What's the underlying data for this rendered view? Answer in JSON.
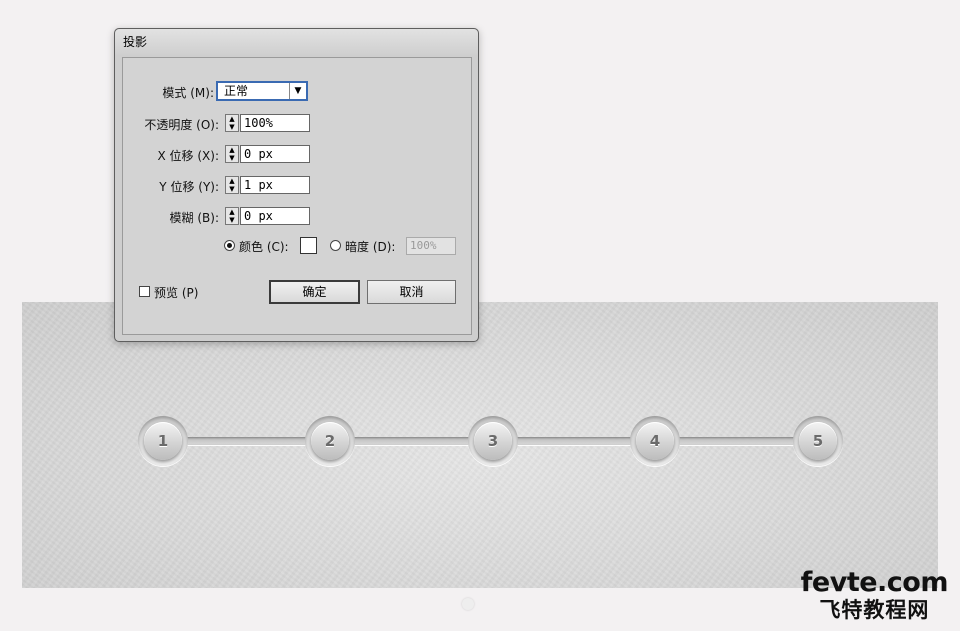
{
  "dialog": {
    "title": "投影",
    "mode_label": "模式 (M):",
    "mode_value": "正常",
    "opacity_label": "不透明度 (O):",
    "opacity_value": "100%",
    "x_offset_label": "X 位移 (X):",
    "x_offset_value": "0 px",
    "y_offset_label": "Y 位移 (Y):",
    "y_offset_value": "1 px",
    "blur_label": "模糊 (B):",
    "blur_value": "0 px",
    "color_label": "颜色 (C):",
    "color_swatch": "#ffffff",
    "darkness_label": "暗度 (D):",
    "darkness_value": "100%",
    "preview_label": "预览 (P)",
    "ok_label": "确定",
    "cancel_label": "取消"
  },
  "steps": [
    "1",
    "2",
    "3",
    "4",
    "5"
  ],
  "watermark": {
    "url": "fevte.com",
    "name": "飞特教程网"
  },
  "colors": {
    "dialog_bg": "#cecece",
    "focus_border": "#3a6ab2",
    "canvas_bg": "#dcdcdc"
  }
}
